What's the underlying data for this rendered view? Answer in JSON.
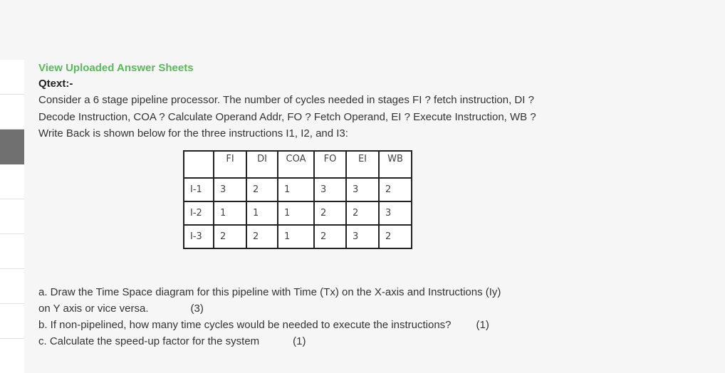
{
  "header": {
    "link_title": "View Uploaded Answer Sheets",
    "qtext_label": "Qtext:-"
  },
  "question": {
    "intro": "Consider a 6 stage pipeline processor. The number of cycles needed in stages FI ? fetch instruction, DI ? Decode Instruction, COA ? Calculate Operand Addr, FO ? Fetch Operand, EI ? Execute Instruction, WB ? Write Back is shown below for the three instructions I1, I2, and I3:",
    "table": {
      "headers": [
        "",
        "FI",
        "DI",
        "COA",
        "FO",
        "EI",
        "WB"
      ],
      "rows": [
        [
          "I-1",
          "3",
          "2",
          "1",
          "3",
          "3",
          "2"
        ],
        [
          "I-2",
          "1",
          "1",
          "1",
          "2",
          "2",
          "3"
        ],
        [
          "I-3",
          "2",
          "2",
          "1",
          "2",
          "3",
          "2"
        ]
      ]
    },
    "parts": [
      {
        "line1": "a. Draw the Time Space diagram for this pipeline with Time (Tx) on the X-axis and Instructions (Iy)",
        "line2": "on Y axis or vice versa.",
        "marks": "(3)"
      },
      {
        "text": "b. If non-pipelined, how many time cycles would be needed to execute the instructions?",
        "marks": "(1)"
      },
      {
        "text": "c. Calculate the speed-up factor for the system",
        "marks": "(1)"
      }
    ]
  },
  "colors": {
    "link": "#5cb85c",
    "sidebar_active": "#707070",
    "background": "#f6f6f6"
  }
}
